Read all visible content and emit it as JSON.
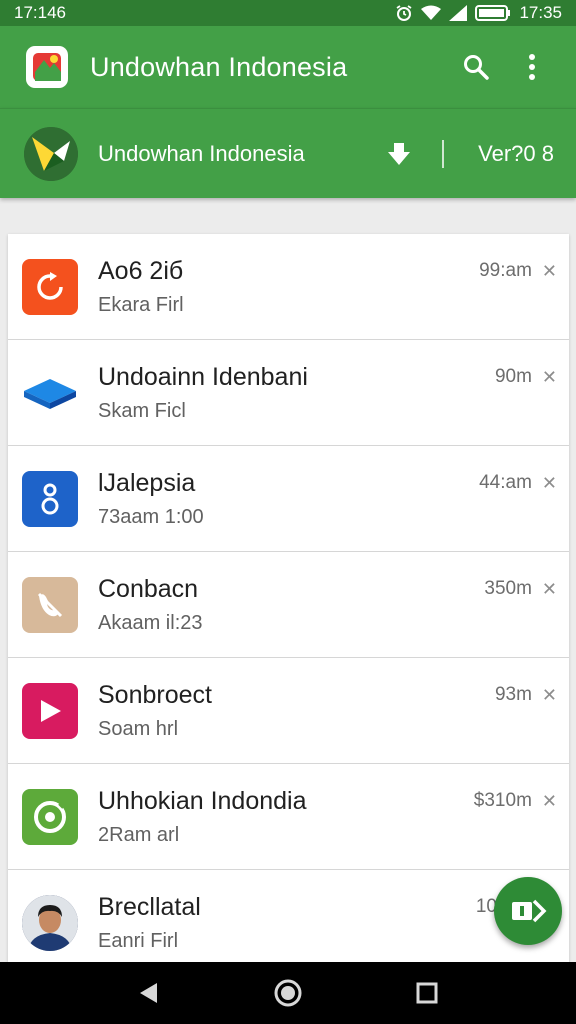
{
  "status_bar": {
    "time_left": "17:146",
    "time_right": "17:35"
  },
  "app_bar": {
    "title": "Undowhan Indonesia",
    "icons": [
      "search-icon",
      "more-vert-icon"
    ]
  },
  "sub_bar": {
    "title": "Undowhan Indonesia",
    "version": "Ver?0 8",
    "icons": [
      "download-icon"
    ]
  },
  "items": [
    {
      "title": "Ao6 2iб",
      "subtitle": "Ekara Firl",
      "time": "99:am",
      "icon": "red-refresh-icon",
      "color": "#f4511e"
    },
    {
      "title": "Undoainn Idenbani",
      "subtitle": "Skam Ficl",
      "time": "90m",
      "icon": "blue-box-icon",
      "color": "#1e88e5"
    },
    {
      "title": "lJalepsia",
      "subtitle": "73aam 1:00",
      "time": "44:am",
      "icon": "blue-info-icon",
      "color": "#1e63c9"
    },
    {
      "title": "Conbacn",
      "subtitle": "Akaam il:23",
      "time": "350m",
      "icon": "phone-off-icon",
      "color": "#d7b99a"
    },
    {
      "title": "Sonbroect",
      "subtitle": "Soam hrl",
      "time": "93m",
      "icon": "play-icon",
      "color": "#d81b60"
    },
    {
      "title": "Uhhokian Indondia",
      "subtitle": "2Ram arl",
      "time": "$310m",
      "icon": "green-target-icon",
      "color": "#5daa3a"
    },
    {
      "title": "Brecllatal",
      "subtitle": "Eanri Firl",
      "time": "10",
      "icon": "avatar",
      "color": "#1f2f5a"
    }
  ],
  "fab": {
    "icon": "forward-icon"
  },
  "nav_bar": {
    "icons": [
      "back-icon",
      "home-icon",
      "recents-icon"
    ]
  },
  "colors": {
    "primary": "#43a047",
    "primary_dark": "#2f7d32",
    "fab": "#2e8b36"
  }
}
